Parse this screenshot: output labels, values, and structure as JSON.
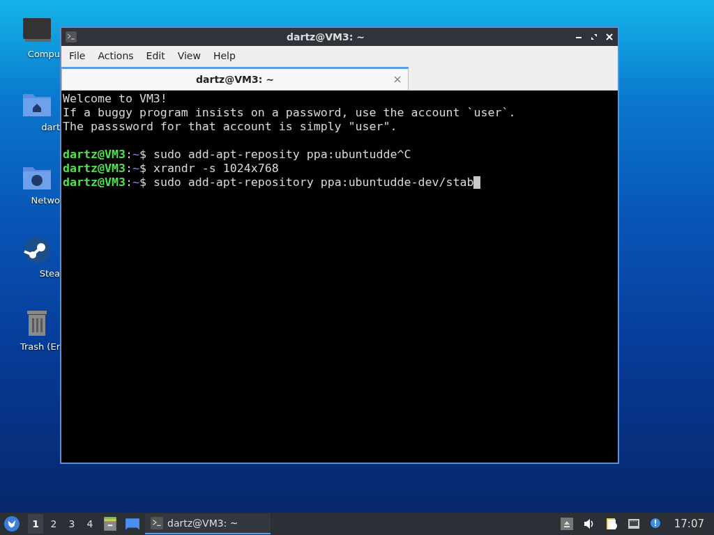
{
  "desktop_icons": [
    {
      "kind": "computer",
      "label": "Compu"
    },
    {
      "kind": "home",
      "label": "dart"
    },
    {
      "kind": "network",
      "label": "Netwo"
    },
    {
      "kind": "steam",
      "label": "Stea"
    },
    {
      "kind": "trash",
      "label": "Trash (Er"
    }
  ],
  "window": {
    "title": "dartz@VM3: ~",
    "menu": [
      "File",
      "Actions",
      "Edit",
      "View",
      "Help"
    ],
    "tabs": [
      {
        "label": "dartz@VM3: ~",
        "selected": true
      }
    ],
    "lines": [
      {
        "kind": "text",
        "text": "Welcome to VM3!"
      },
      {
        "kind": "text",
        "text": "If a buggy program insists on a password, use the account `user`."
      },
      {
        "kind": "text",
        "text": "The passsword for that account is simply \"user\"."
      },
      {
        "kind": "blank"
      },
      {
        "kind": "prompt",
        "user": "dartz@VM3",
        "sep": ":",
        "dir": "~",
        "command": "$ sudo add-apt-reposity ppa:ubuntudde^C",
        "cursor": false
      },
      {
        "kind": "prompt",
        "user": "dartz@VM3",
        "sep": ":",
        "dir": "~",
        "command": "$ xrandr -s 1024x768",
        "cursor": false
      },
      {
        "kind": "prompt",
        "user": "dartz@VM3",
        "sep": ":",
        "dir": "~",
        "command": "$ sudo add-apt-repository ppa:ubuntudde-dev/stab",
        "cursor": true
      }
    ]
  },
  "taskbar": {
    "workspaces": [
      {
        "label": "1",
        "selected": true
      },
      {
        "label": "2",
        "selected": false
      },
      {
        "label": "3",
        "selected": false
      },
      {
        "label": "4",
        "selected": false
      }
    ],
    "tasks": [
      {
        "label": "dartz@VM3: ~",
        "selected": true
      }
    ],
    "clock": "17:07"
  }
}
